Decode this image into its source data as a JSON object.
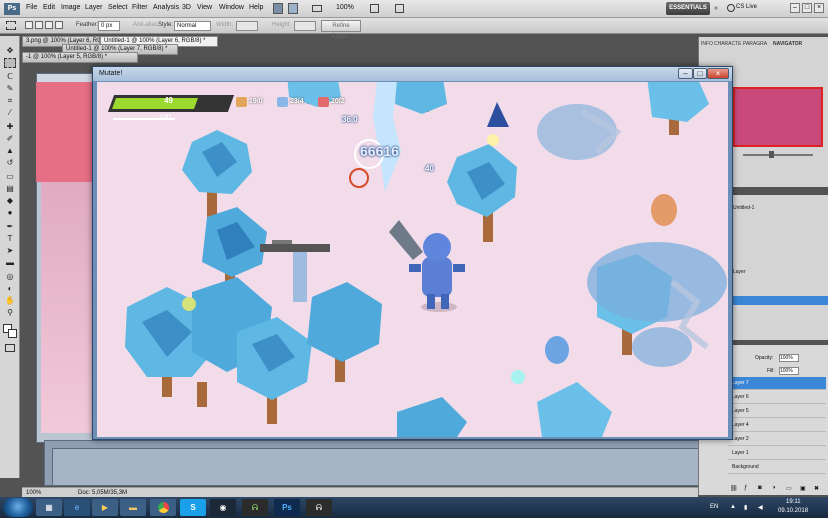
{
  "photoshop": {
    "logo": "Ps",
    "menu": [
      "File",
      "Edit",
      "Image",
      "Layer",
      "Select",
      "Filter",
      "Analysis",
      "3D",
      "View",
      "Window",
      "Help"
    ],
    "zoom": "100%",
    "options": {
      "feather_label": "Feather:",
      "feather_value": "0 px",
      "antialias_label": "Anti-alias",
      "style_label": "Style:",
      "style_value": "Normal",
      "width_label": "Width:",
      "height_label": "Height:",
      "refine_button": "Refine Edge..."
    },
    "workspace": "ESSENTIALS",
    "cs_live": "CS Live",
    "doc_tabs": [
      "3.png @ 100% (Layer 6, RGB/8)",
      "Untitled-1 @ 100% (Layer 6, RGB/8) *",
      "Untitled-1 @ 100% (Layer 7, RGB/8) *",
      "-1 @ 100% (Layer 5, RGB/8) *"
    ],
    "panel_tabs": [
      "INFO",
      "CHARACTE",
      "PARAGRA",
      "NAVIGATOR"
    ],
    "mid_panel_items": [
      "Untitled-1",
      "Layer"
    ],
    "layers_panel": {
      "opacity_label": "Opacity:",
      "opacity_value": "100%",
      "fill_label": "Fill:",
      "fill_value": "100%",
      "layers": [
        "Layer 7",
        "Layer 6",
        "Layer 5",
        "Layer 4",
        "Layer 2",
        "Layer 1",
        "Background"
      ],
      "selected": "Layer 7"
    },
    "status": {
      "zoom": "100%",
      "doc": "Doc: 5,05M/35,3M"
    }
  },
  "game": {
    "window_title": "Mutate!",
    "hud": {
      "hp": "49",
      "hp_fraction": 0.72,
      "xp": "100",
      "stat1": "19/0",
      "stat2": "23/4",
      "stat3": "20/2"
    },
    "floating_numbers": [
      "36.0",
      "66616",
      "40"
    ]
  },
  "taskbar": {
    "apps": [
      "explorer",
      "ie",
      "media",
      "folder",
      "chrome",
      "skype",
      "steam",
      "app",
      "photoshop",
      "app2"
    ],
    "lang": "EN",
    "time": "19:11",
    "date": "09.10.2018"
  }
}
